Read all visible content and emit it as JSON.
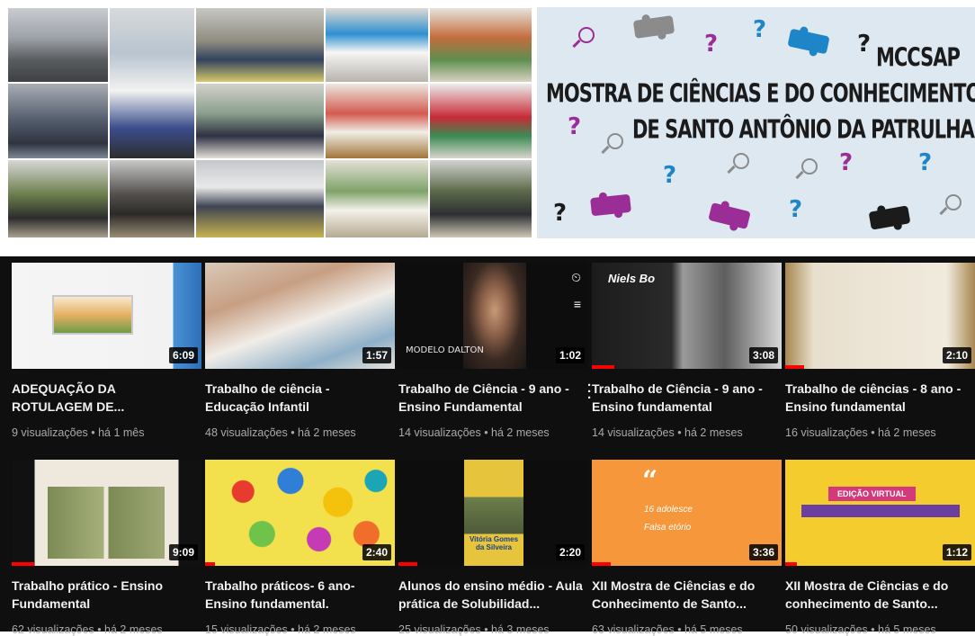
{
  "banner": {
    "acronym": "MCCSAP",
    "title_line1": "MOSTRA DE CIÊNCIAS E DO CONHECIMENTO",
    "title_line2": "DE SANTO ANTÔNIO DA PATRULHA",
    "colors": {
      "purple": "#9b2d96",
      "blue": "#1e86c8",
      "gray": "#8b8b8b",
      "black": "#1b1b1b",
      "bg": "#dde8f0"
    }
  },
  "videos": [
    {
      "title": "ADEQUAÇÃO DA ROTULAGEM DE...",
      "meta": "9 visualizações • há 1 mês",
      "duration": "6:09",
      "progress": 0.0,
      "thumb_text": ""
    },
    {
      "title": "Trabalho de ciência - Educação Infantil",
      "meta": "48 visualizações • há 2 meses",
      "duration": "1:57",
      "progress": 0.0,
      "thumb_text": ""
    },
    {
      "title": "Trabalho de Ciência - 9 ano - Ensino Fundamental",
      "meta": "14 visualizações • há 2 meses",
      "duration": "1:02",
      "progress": 0.0,
      "thumb_text": "MODELO DALTON"
    },
    {
      "title": "Trabalho de Ciência - 9 ano - Ensino fundamental",
      "meta": "14 visualizações • há 2 meses",
      "duration": "3:08",
      "progress": 0.12,
      "thumb_text": "Niels Bo"
    },
    {
      "title": "Trabalho de ciências - 8 ano - Ensino fundamental",
      "meta": "16 visualizações • há 2 meses",
      "duration": "2:10",
      "progress": 0.1,
      "thumb_text": ""
    },
    {
      "title": "Trabalho prático - Ensino Fundamental",
      "meta": "62 visualizações • há 2 meses",
      "duration": "9:09",
      "progress": 0.12,
      "thumb_text": ""
    },
    {
      "title": "Trabalho práticos- 6 ano- Ensino fundamental.",
      "meta": "15 visualizações • há 2 meses",
      "duration": "2:40",
      "progress": 0.05,
      "thumb_text": ""
    },
    {
      "title": "Alunos do ensino médio - Aula prática de Solubilidad...",
      "meta": "25 visualizações • há 3 meses",
      "duration": "2:20",
      "progress": 0.1,
      "thumb_text": "Vitória Gomes da Silveira"
    },
    {
      "title": "XII Mostra de Ciências e do Conhecimento de Santo...",
      "meta": "63 visualizações • há 5 meses",
      "duration": "3:36",
      "progress": 0.1,
      "thumb_text": "16 adolesce Falsa etório"
    },
    {
      "title": "XII Mostra de Ciências e do conhecimento de Santo...",
      "meta": "50 visualizações • há 5 meses",
      "duration": "1:12",
      "progress": 0.06,
      "thumb_text": "EDIÇÃO VIRTUAL"
    }
  ]
}
